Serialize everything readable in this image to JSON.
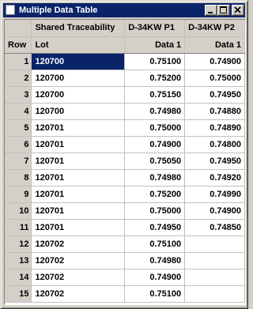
{
  "window": {
    "title": "Multiple Data Table"
  },
  "table": {
    "group_headers": [
      "",
      "Shared Traceability",
      "D-34KW P1",
      "D-34KW P2"
    ],
    "column_headers": [
      "Row",
      "Lot",
      "Data 1",
      "Data 1"
    ],
    "selected_row": 1,
    "rows": [
      {
        "row": "1",
        "lot": "120700",
        "p1": "0.75100",
        "p2": "0.74900"
      },
      {
        "row": "2",
        "lot": "120700",
        "p1": "0.75200",
        "p2": "0.75000"
      },
      {
        "row": "3",
        "lot": "120700",
        "p1": "0.75150",
        "p2": "0.74950"
      },
      {
        "row": "4",
        "lot": "120700",
        "p1": "0.74980",
        "p2": "0.74880"
      },
      {
        "row": "5",
        "lot": "120701",
        "p1": "0.75000",
        "p2": "0.74890"
      },
      {
        "row": "6",
        "lot": "120701",
        "p1": "0.74900",
        "p2": "0.74800"
      },
      {
        "row": "7",
        "lot": "120701",
        "p1": "0.75050",
        "p2": "0.74950"
      },
      {
        "row": "8",
        "lot": "120701",
        "p1": "0.74980",
        "p2": "0.74920"
      },
      {
        "row": "9",
        "lot": "120701",
        "p1": "0.75200",
        "p2": "0.74990"
      },
      {
        "row": "10",
        "lot": "120701",
        "p1": "0.75000",
        "p2": "0.74900"
      },
      {
        "row": "11",
        "lot": "120701",
        "p1": "0.74950",
        "p2": "0.74850"
      },
      {
        "row": "12",
        "lot": "120702",
        "p1": "0.75100",
        "p2": ""
      },
      {
        "row": "13",
        "lot": "120702",
        "p1": "0.74980",
        "p2": ""
      },
      {
        "row": "14",
        "lot": "120702",
        "p1": "0.74900",
        "p2": ""
      },
      {
        "row": "15",
        "lot": "120702",
        "p1": "0.75100",
        "p2": ""
      }
    ]
  },
  "colors": {
    "title_bar": "#0a246a",
    "selection": "#0a246a",
    "face": "#d4d0c8"
  },
  "icons": {
    "app": "document-icon",
    "minimize": "minimize-icon",
    "maximize": "maximize-icon",
    "close": "close-icon"
  }
}
